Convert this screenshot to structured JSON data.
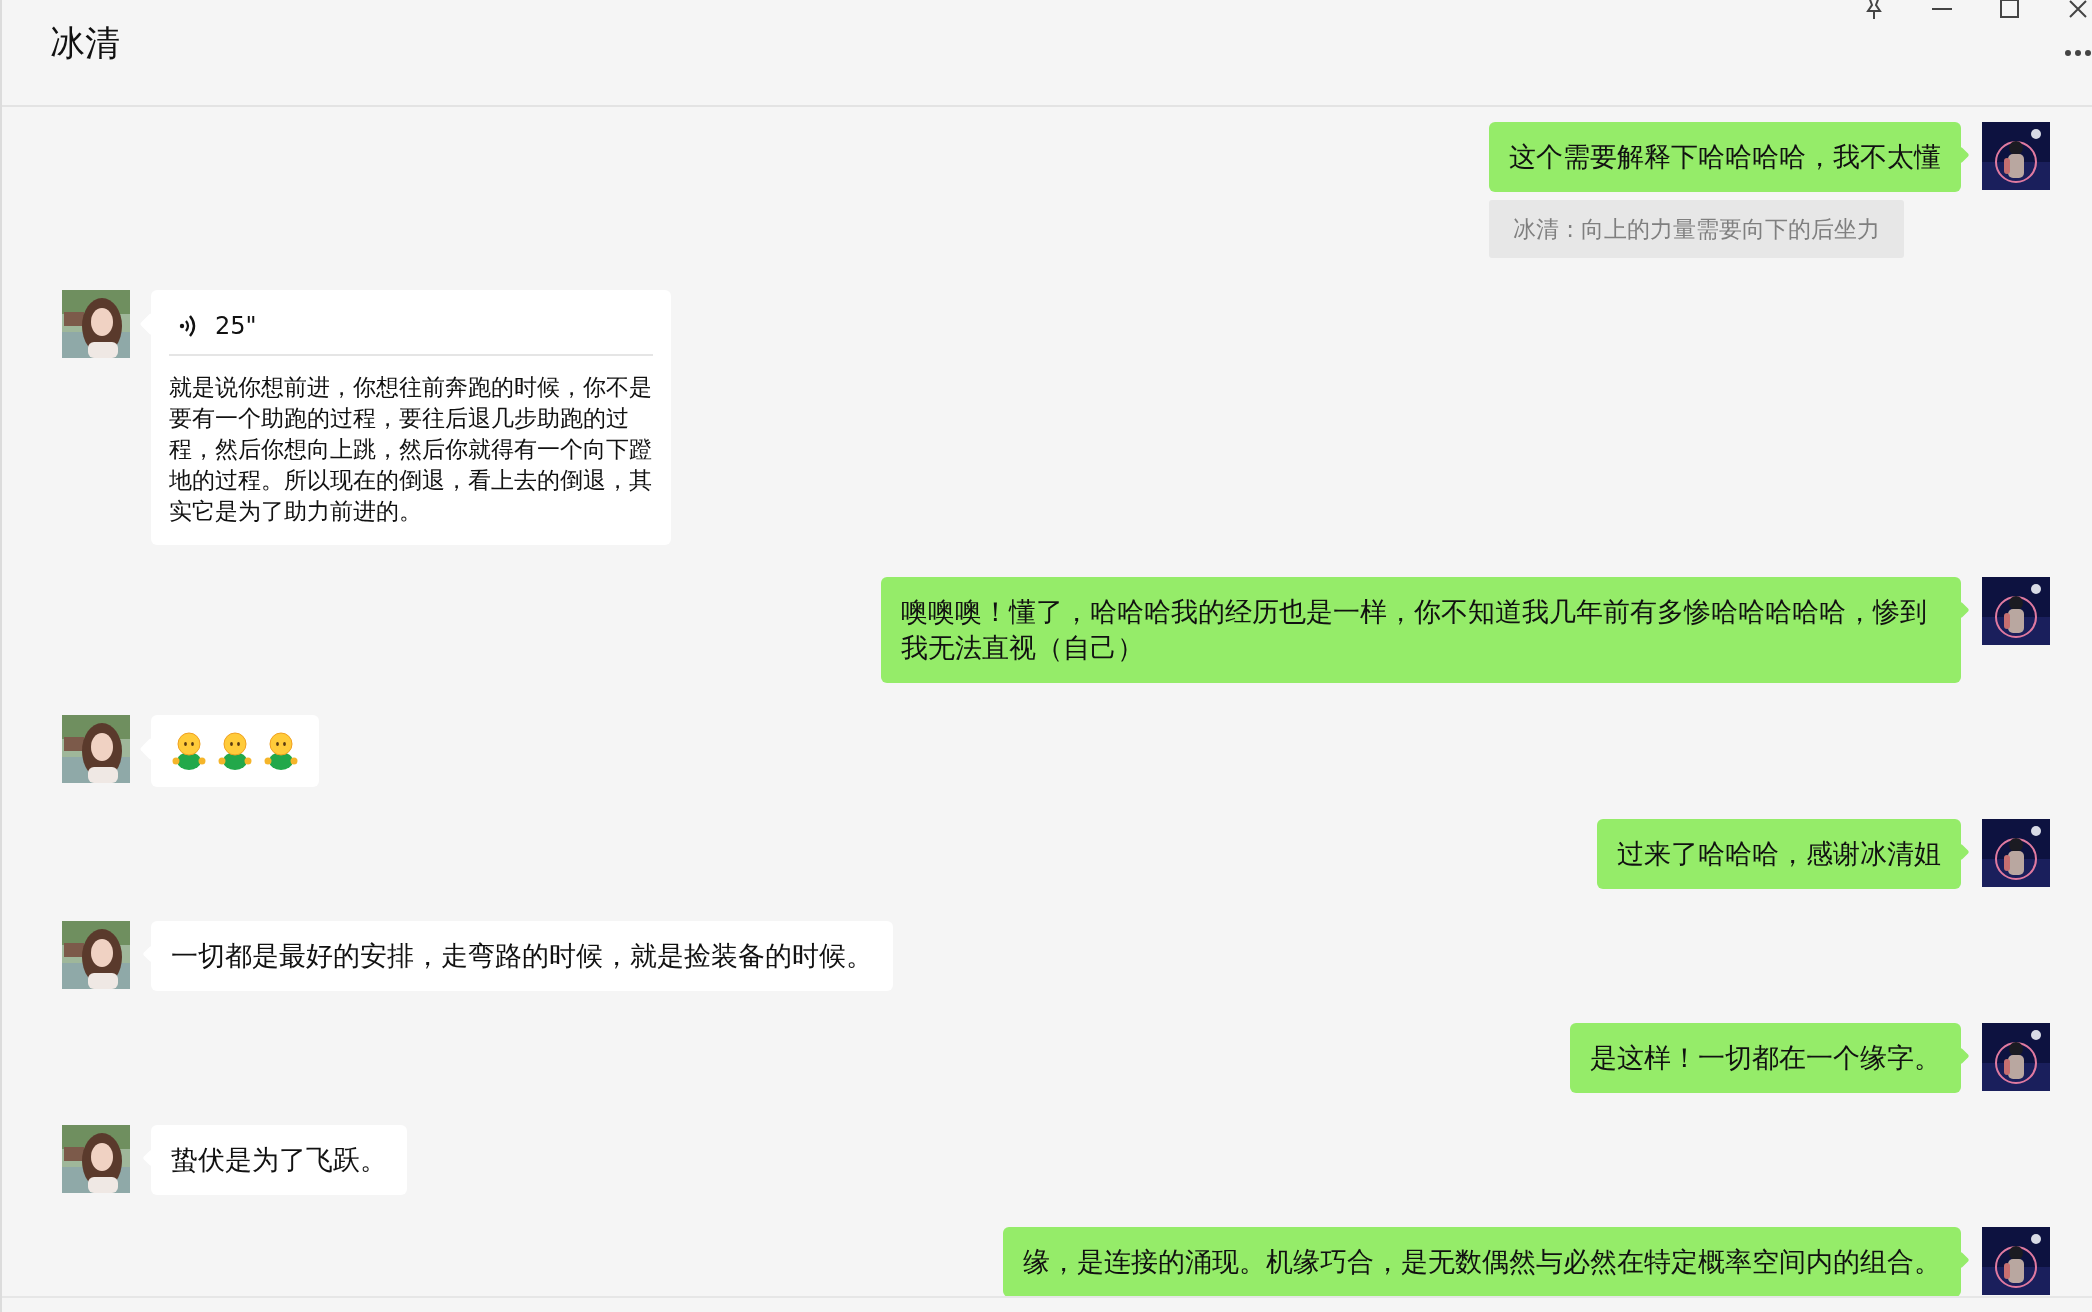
{
  "window": {
    "title": "冰清"
  },
  "messages": [
    {
      "outgoing": true,
      "kind": "text",
      "text": "这个需要解释下哈哈哈哈，我不太懂",
      "quote": "冰清 : 向上的力量需要向下的后坐力"
    },
    {
      "outgoing": false,
      "kind": "voice",
      "duration": "25\"",
      "text": "就是说你想前进，你想往前奔跑的时候，你不是要有一个助跑的过程，要往后退几步助跑的过程，然后你想向上跳，然后你就得有一个向下蹬地的过程。所以现在的倒退，看上去的倒退，其实它是为了助力前进的。"
    },
    {
      "outgoing": true,
      "kind": "text",
      "text": "噢噢噢！懂了，哈哈哈我的经历也是一样，你不知道我几年前有多惨哈哈哈哈哈，惨到我无法直视（自己）"
    },
    {
      "outgoing": false,
      "kind": "stickers",
      "stickers": [
        {
          "kind": "figure"
        },
        {
          "kind": "figure"
        },
        {
          "kind": "figure"
        }
      ]
    },
    {
      "outgoing": true,
      "kind": "text",
      "text": "过来了哈哈哈，感谢冰清姐"
    },
    {
      "outgoing": false,
      "kind": "text",
      "text": "一切都是最好的安排，走弯路的时候，就是捡装备的时候。"
    },
    {
      "outgoing": true,
      "kind": "text",
      "text": "是这样！一切都在一个缘字。"
    },
    {
      "outgoing": false,
      "kind": "text",
      "text": "蛰伏是为了飞跃。"
    },
    {
      "outgoing": true,
      "kind": "text",
      "text": "缘，是连接的涌现。机缘巧合，是无数偶然与必然在特定概率空间内的组合。"
    }
  ]
}
